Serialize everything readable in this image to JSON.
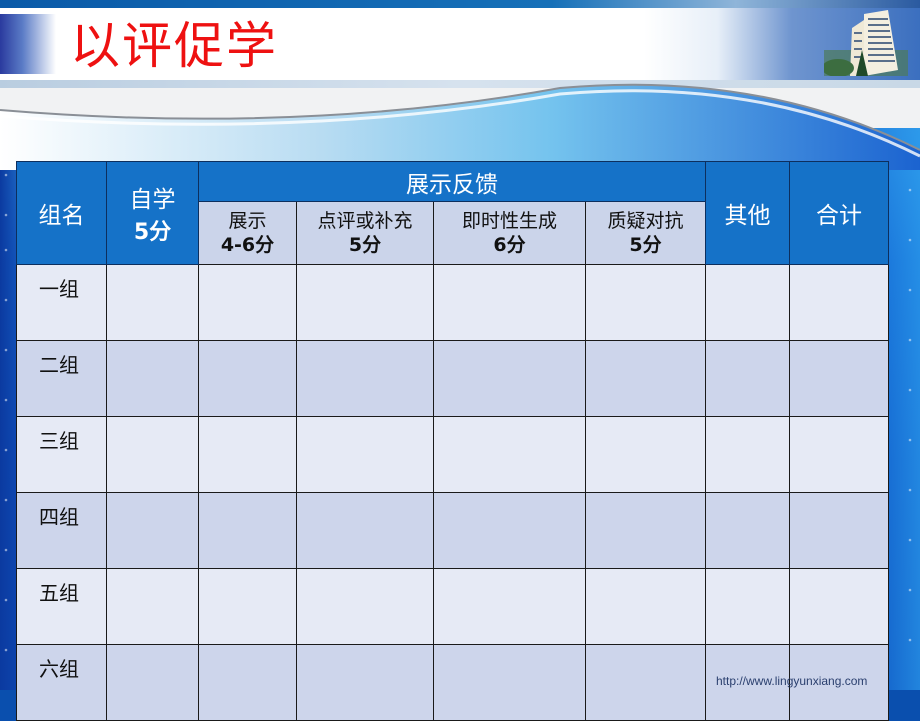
{
  "slide": {
    "title": "以评促学",
    "watermark": "http://www.lingyunxiang.com",
    "colors": {
      "title": "#ee1111",
      "header_dark": "#1572c8",
      "header_light": "#cbd4ea",
      "row_odd": "#e6eaf5",
      "row_even": "#cdd5eb"
    }
  },
  "table": {
    "headers": {
      "group": "组名",
      "self_study": {
        "label": "自学",
        "points": "5分"
      },
      "presentation_feedback": "展示反馈",
      "sub": [
        {
          "label": "展示",
          "points": "4-6分"
        },
        {
          "label": "点评或补充",
          "points": "5分"
        },
        {
          "label": "即时性生成",
          "points": "6分"
        },
        {
          "label": "质疑对抗",
          "points": "5分"
        }
      ],
      "other": "其他",
      "total": "合计"
    },
    "rows": [
      {
        "group": "一组"
      },
      {
        "group": "二组"
      },
      {
        "group": "三组"
      },
      {
        "group": "四组"
      },
      {
        "group": "五组"
      },
      {
        "group": "六组"
      }
    ]
  }
}
